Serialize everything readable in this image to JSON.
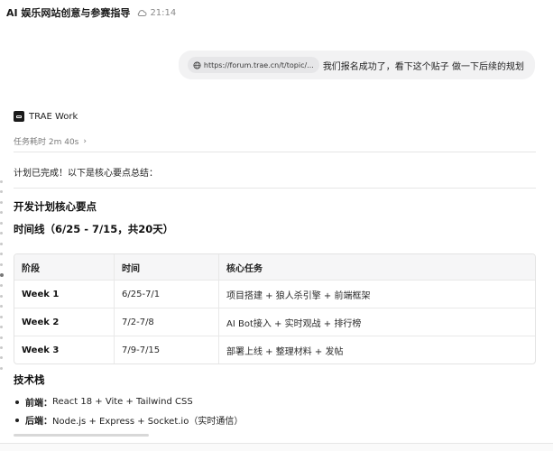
{
  "topbar": {
    "title": "AI 娱乐网站创意与参赛指导",
    "cloud_icon": "cloud-icon",
    "time": "21:14"
  },
  "user_message": {
    "link_url": "https://forum.trae.cn/t/topic/...",
    "text": "我们报名成功了，看下这个贴子 做一下后续的规划"
  },
  "agent": {
    "name": "TRAE Work",
    "duration": "任务耗时 2m 40s",
    "chevron": "›"
  },
  "content": {
    "summary": "计划已完成！以下是核心要点总结：",
    "plan_heading": "开发计划核心要点",
    "timeline_heading": "时间线（6/25 - 7/15，共20天）",
    "table": {
      "headers": [
        "阶段",
        "时间",
        "核心任务"
      ],
      "rows": [
        [
          "Week 1",
          "6/25-7/1",
          "项目搭建 + 狼人杀引擎 + 前端框架"
        ],
        [
          "Week 2",
          "7/2-7/8",
          "AI Bot接入 + 实时观战 + 排行榜"
        ],
        [
          "Week 3",
          "7/9-7/15",
          "部署上线 + 整理材料 + 发帖"
        ]
      ]
    },
    "tech_heading": "技术栈",
    "tech": [
      {
        "key": "前端：",
        "value": "React 18 + Vite + Tailwind CSS"
      },
      {
        "key": "后端：",
        "value": "Node.js + Express + Socket.io（实时通信）"
      }
    ]
  }
}
